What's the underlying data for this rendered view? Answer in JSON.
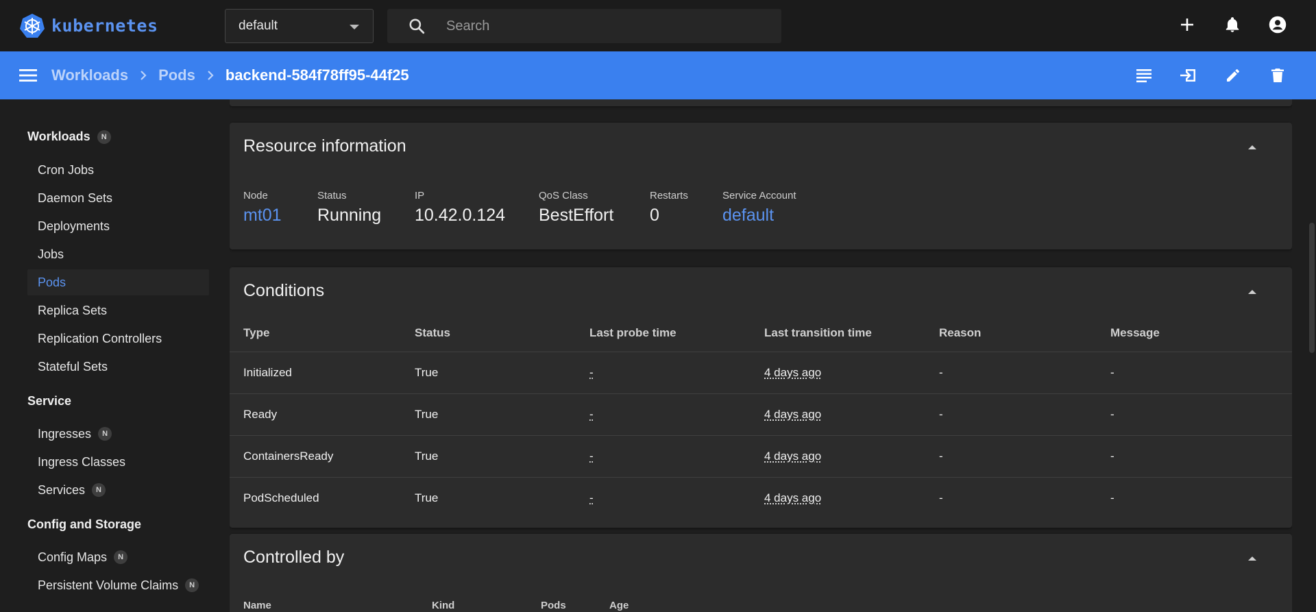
{
  "topbar": {
    "logo_text": "kubernetes",
    "namespace": "default",
    "search_placeholder": "Search"
  },
  "header": {
    "breadcrumbs": [
      "Workloads",
      "Pods"
    ],
    "current": "backend-584f78ff95-44f25"
  },
  "sidebar": {
    "badge": "N",
    "groups": {
      "workloads": "Workloads",
      "service": "Service",
      "config": "Config and Storage"
    },
    "workloads_items": [
      "Cron Jobs",
      "Daemon Sets",
      "Deployments",
      "Jobs",
      "Pods",
      "Replica Sets",
      "Replication Controllers",
      "Stateful Sets"
    ],
    "service_items": [
      "Ingresses",
      "Ingress Classes",
      "Services"
    ],
    "config_items": [
      "Config Maps",
      "Persistent Volume Claims"
    ],
    "active": "Pods"
  },
  "resource_info": {
    "title": "Resource information",
    "fields": [
      {
        "label": "Node",
        "value": "mt01",
        "link": true
      },
      {
        "label": "Status",
        "value": "Running",
        "link": false
      },
      {
        "label": "IP",
        "value": "10.42.0.124",
        "link": false
      },
      {
        "label": "QoS Class",
        "value": "BestEffort",
        "link": false
      },
      {
        "label": "Restarts",
        "value": "0",
        "link": false
      },
      {
        "label": "Service Account",
        "value": "default",
        "link": true
      }
    ]
  },
  "conditions": {
    "title": "Conditions",
    "columns": [
      "Type",
      "Status",
      "Last probe time",
      "Last transition time",
      "Reason",
      "Message"
    ],
    "rows": [
      [
        "Initialized",
        "True",
        "-",
        "4 days ago",
        "-",
        "-"
      ],
      [
        "Ready",
        "True",
        "-",
        "4 days ago",
        "-",
        "-"
      ],
      [
        "ContainersReady",
        "True",
        "-",
        "4 days ago",
        "-",
        "-"
      ],
      [
        "PodScheduled",
        "True",
        "-",
        "4 days ago",
        "-",
        "-"
      ]
    ]
  },
  "controlled_by": {
    "title": "Controlled by",
    "columns": [
      "Name",
      "Kind",
      "Pods",
      "Age"
    ]
  },
  "colors": {
    "accent": "#3a80ef",
    "link": "#5b93f0",
    "card": "#2c2c2c"
  }
}
